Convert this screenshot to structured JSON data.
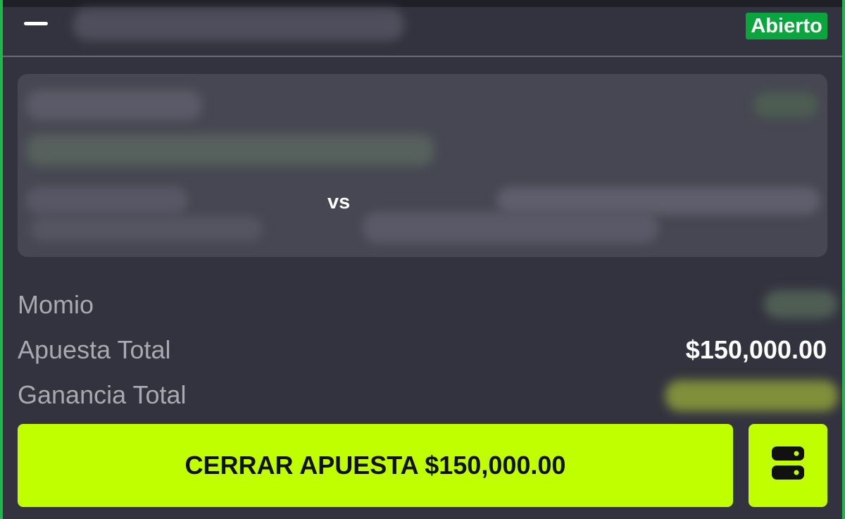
{
  "header": {
    "status_badge": "Abierto"
  },
  "match": {
    "vs_label": "vs"
  },
  "summary": {
    "odds_label": "Momio",
    "total_bet_label": "Apuesta Total",
    "total_bet_value": "$150,000.00",
    "total_win_label": "Ganancia Total"
  },
  "actions": {
    "close_bet_label": "CERRAR APUESTA $150,000.00"
  },
  "icons": {
    "collapse": "minus-icon",
    "options": "server-stack-icon"
  },
  "colors": {
    "card_background": "#33333f",
    "status_green": "#0aa53c",
    "edge_green": "#1eb84a",
    "action_lime": "#bfff00",
    "match_panel": "#474753"
  }
}
